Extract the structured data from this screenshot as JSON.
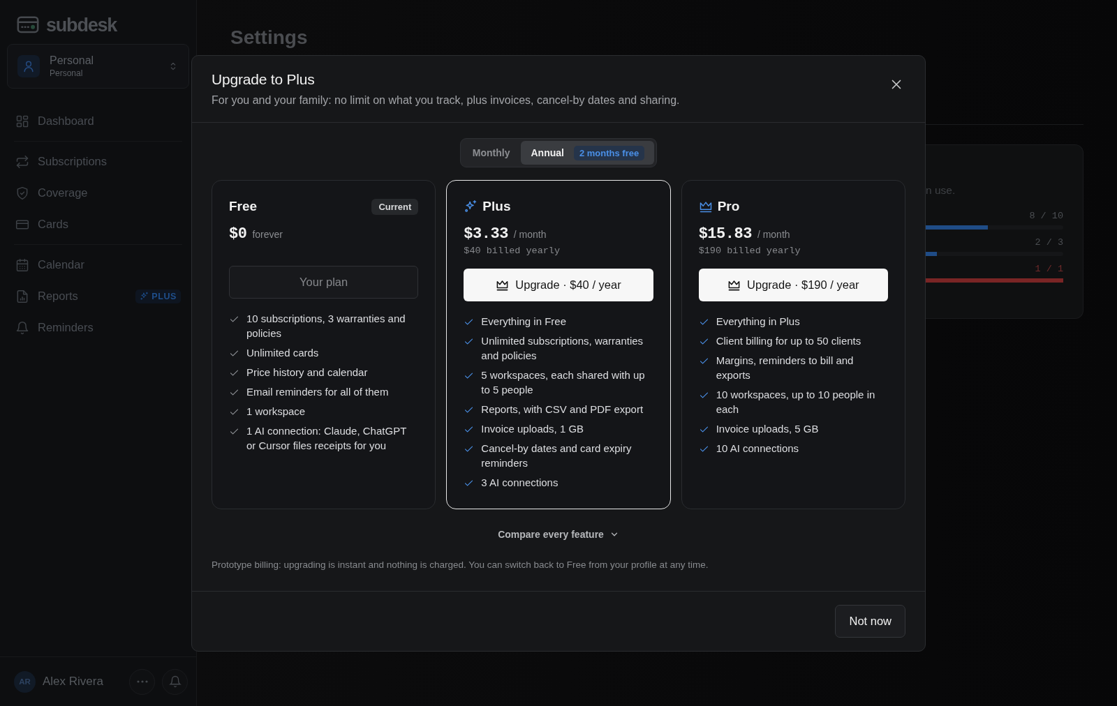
{
  "sidebar": {
    "logo": "subdesk",
    "workspace": {
      "name": "Personal",
      "type": "Personal"
    },
    "nav_groups": [
      [
        {
          "label": "Dashboard"
        }
      ],
      [
        {
          "label": "Subscriptions"
        },
        {
          "label": "Coverage"
        },
        {
          "label": "Cards"
        }
      ],
      [
        {
          "label": "Calendar"
        },
        {
          "label": "Reports",
          "badge": "PLUS"
        },
        {
          "label": "Reminders"
        }
      ]
    ],
    "user": {
      "initials": "AR",
      "name": "Alex Rivera"
    }
  },
  "page": {
    "title": "Settings",
    "usage": {
      "note": "n use.",
      "meters": [
        {
          "reading": "8 / 10",
          "level": 0.45,
          "color": "#1f4c86"
        },
        {
          "reading": "2 / 3",
          "level": 0.08,
          "color": "#1f4c86"
        },
        {
          "reading": "1 / 1",
          "level": 1,
          "color": "#7a2525"
        }
      ]
    }
  },
  "modal": {
    "title": "Upgrade to Plus",
    "subtitle": "For you and your family: no limit on what you track, plus invoices, cancel-by dates and sharing.",
    "billing_toggle": [
      {
        "label": "Monthly",
        "selected": false
      },
      {
        "label": "Annual",
        "selected": true,
        "badge": "2 months free"
      }
    ],
    "plans": [
      {
        "kind": "free",
        "name": "Free",
        "badge": "Current",
        "price": "$0",
        "period": "forever",
        "highlighted": false,
        "button": {
          "kind": "current",
          "label": "Your plan"
        },
        "features": [
          "10 subscriptions, 3 warranties and policies",
          "Unlimited cards",
          "Price history and calendar",
          "Email reminders for all of them",
          "1 workspace",
          "1 AI connection: Claude, ChatGPT or Cursor files receipts for you"
        ]
      },
      {
        "kind": "plus",
        "name": "Plus",
        "price": "$3.33",
        "period": "/ month",
        "billed": "$40 billed yearly",
        "highlighted": true,
        "button": {
          "kind": "upgrade",
          "label": "Upgrade · $40 / year"
        },
        "features": [
          "Everything in Free",
          "Unlimited subscriptions, warranties and policies",
          "5 workspaces, each shared with up to 5 people",
          "Reports, with CSV and PDF export",
          "Invoice uploads, 1 GB",
          "Cancel-by dates and card expiry reminders",
          "3 AI connections"
        ]
      },
      {
        "kind": "pro",
        "name": "Pro",
        "price": "$15.83",
        "period": "/ month",
        "billed": "$190 billed yearly",
        "highlighted": false,
        "button": {
          "kind": "upgrade",
          "label": "Upgrade · $190 / year"
        },
        "features": [
          "Everything in Plus",
          "Client billing for up to 50 clients",
          "Margins, reminders to bill and exports",
          "10 workspaces, up to 10 people in each",
          "Invoice uploads, 5 GB",
          "10 AI connections"
        ]
      }
    ],
    "compare": "Compare every feature",
    "note": "Prototype billing: upgrading is instant and nothing is charged. You can switch back to Free from your profile at any time.",
    "dismiss": "Not now"
  }
}
